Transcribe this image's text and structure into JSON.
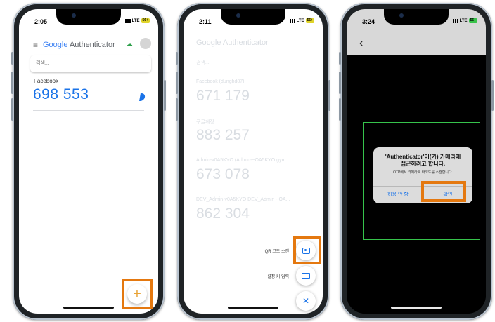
{
  "phone1": {
    "status": {
      "time": "2:05",
      "network": "LTE",
      "battery": "56+"
    },
    "app_title": {
      "google": "Google",
      "authenticator": "Authenticator"
    },
    "search_placeholder": "검색...",
    "account": {
      "name": "Facebook",
      "code": "698 553"
    },
    "fab_icon": "plus-icon"
  },
  "phone2": {
    "status": {
      "time": "2:11",
      "network": "LTE",
      "battery": "56+"
    },
    "app_title": "Google Authenticator",
    "search_placeholder": "검색...",
    "accounts": [
      {
        "name": "Facebook (dunghd87)",
        "code": "671 179"
      },
      {
        "name": "구글계정",
        "code": "883 257"
      },
      {
        "name": "Admin-v0A5KYO (Admin-~OA5KYO.gym...",
        "code": "673 078"
      },
      {
        "name": "DEV_Admin-v0A5KYO DEV_Admin - OA...",
        "code": "862 304"
      }
    ],
    "actions": {
      "qr_scan": "QR 코드 스캔",
      "enter_key": "설정 키 입력"
    }
  },
  "phone3": {
    "status": {
      "time": "3:24",
      "network": "LTE",
      "battery": "56+"
    },
    "dialog": {
      "title_line1": "'Authenticator'이(가) 카메라에",
      "title_line2": "접근하려고 합니다.",
      "message": "OTP에서 카메라로 바코드를 스캔합니다.",
      "deny": "허용 안 함",
      "allow": "확인"
    }
  },
  "colors": {
    "highlight": "#e4780f",
    "accent": "#1a73e8",
    "scan_frame": "#36c24b"
  }
}
